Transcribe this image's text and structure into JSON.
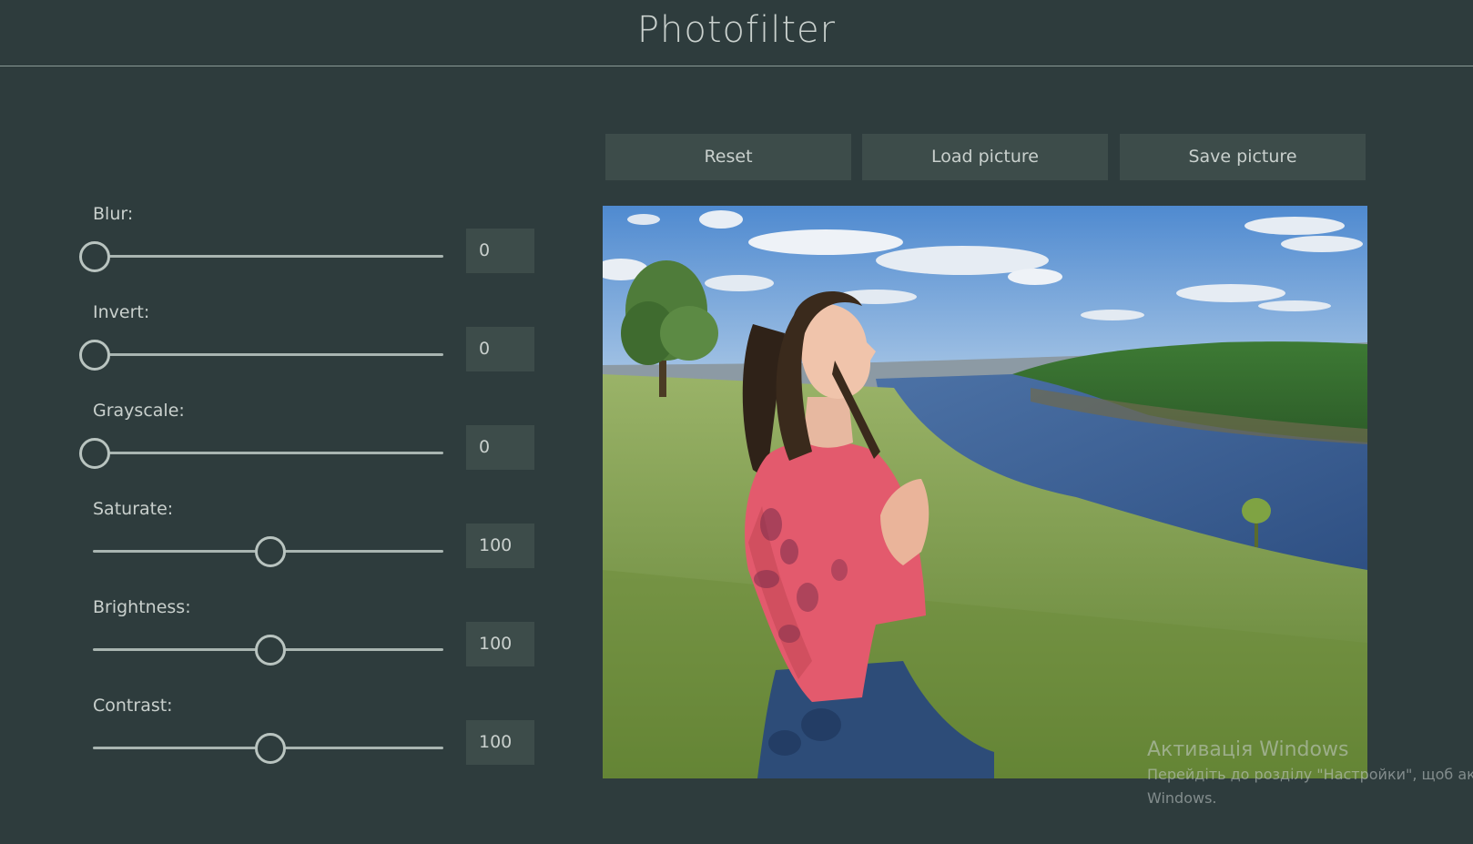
{
  "header": {
    "title": "Photofilter"
  },
  "filters": [
    {
      "label": "Blur:",
      "value": "0",
      "position": 0
    },
    {
      "label": "Invert:",
      "value": "0",
      "position": 0
    },
    {
      "label": "Grayscale:",
      "value": "0",
      "position": 0
    },
    {
      "label": "Saturate:",
      "value": "100",
      "position": 0.5
    },
    {
      "label": "Brightness:",
      "value": "100",
      "position": 0.5
    },
    {
      "label": "Contrast:",
      "value": "100",
      "position": 0.5
    }
  ],
  "buttons": {
    "reset": "Reset",
    "load": "Load picture",
    "save": "Save picture"
  },
  "watermark": {
    "title": "Активація Windows",
    "line1": "Перейдіть до розділу \"Настройки\", щоб акт",
    "line2": "Windows."
  },
  "colors": {
    "background": "#2e3c3d",
    "panel": "#3d4c4a",
    "text": "#c9d0cd",
    "accent": "#b9c4c0"
  }
}
